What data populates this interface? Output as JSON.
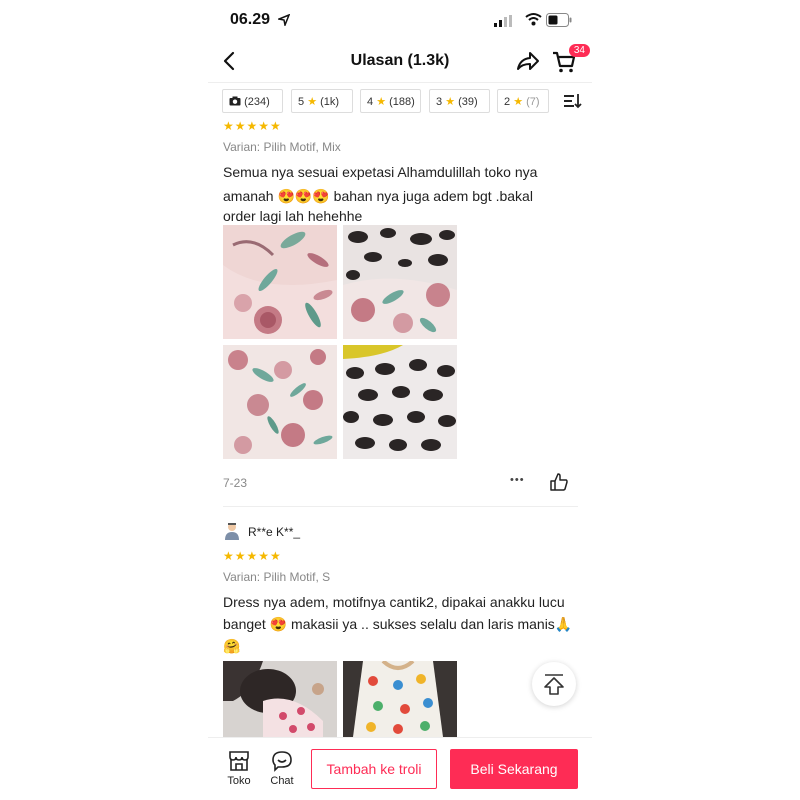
{
  "status_bar": {
    "time": "06.29"
  },
  "header": {
    "title": "Ulasan (1.3k)",
    "cart_count": "34"
  },
  "filters": [
    {
      "count": "(234)",
      "icon": "camera-icon"
    },
    {
      "stars": "5",
      "count": "(1k)"
    },
    {
      "stars": "4",
      "count": "(188)"
    },
    {
      "stars": "3",
      "count": "(39)"
    },
    {
      "stars": "2",
      "count": "(7)"
    }
  ],
  "reviews": [
    {
      "rating": 5,
      "stars": "★★★★★",
      "variant": "Varian: Pilih Motif, Mix",
      "text_line1": "Semua nya sesuai expetasi Alhamdulillah toko nya",
      "text_line2": "amanah 😍😍😍 bahan nya juga adem bgt .bakal",
      "text_line3": "order lagi lah hehehhe",
      "date": "7-23",
      "more": "•••"
    },
    {
      "username": "R**e K**_",
      "rating": 5,
      "stars": "★★★★★",
      "variant": "Varian: Pilih Motif, S",
      "text_line1": "Dress nya adem, motifnya cantik2, dipakai anakku lucu",
      "text_line2": "banget 😍 makasii ya .. sukses selalu dan laris manis🙏",
      "text_line3": "🤗"
    }
  ],
  "bottom_bar": {
    "shop_label": "Toko",
    "chat_label": "Chat",
    "add_cart_label": "Tambah ke troli",
    "buy_label": "Beli Sekarang"
  },
  "colors": {
    "accent": "#fe2c55",
    "star": "#f5b800"
  }
}
